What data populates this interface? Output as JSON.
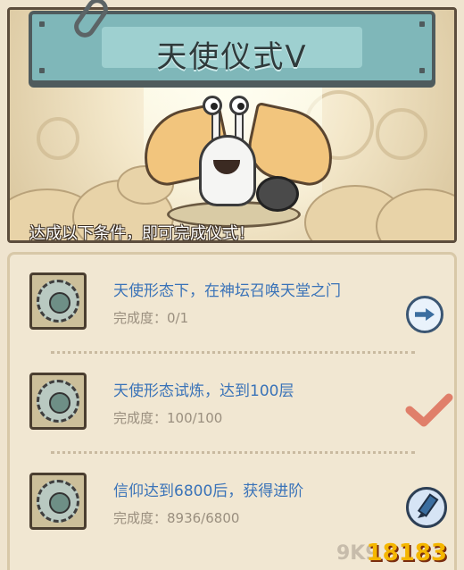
{
  "banner": {
    "title": "天使仪式Ⅴ",
    "caption": "达成以下条件，即可完成仪式！"
  },
  "quests": [
    {
      "title": "天使形态下，在神坛召唤天堂之门",
      "progress": "完成度：0/1",
      "status": "in-progress",
      "action_icon": "arrow-right-icon"
    },
    {
      "title": "天使形态试炼，达到100层",
      "progress": "完成度：100/100",
      "status": "completed",
      "action_icon": "checkmark-icon"
    },
    {
      "title": "信仰达到6800后，获得进阶",
      "progress": "完成度：8936/6800",
      "status": "claimable",
      "action_icon": "pencil-icon"
    }
  ],
  "watermark": {
    "faint": "9K9",
    "brand": "18183"
  },
  "colors": {
    "title_plate": "#7fb7b9",
    "quest_title": "#3a73b8",
    "progress_text": "#9a8f7f",
    "check": "#e07f6a"
  }
}
